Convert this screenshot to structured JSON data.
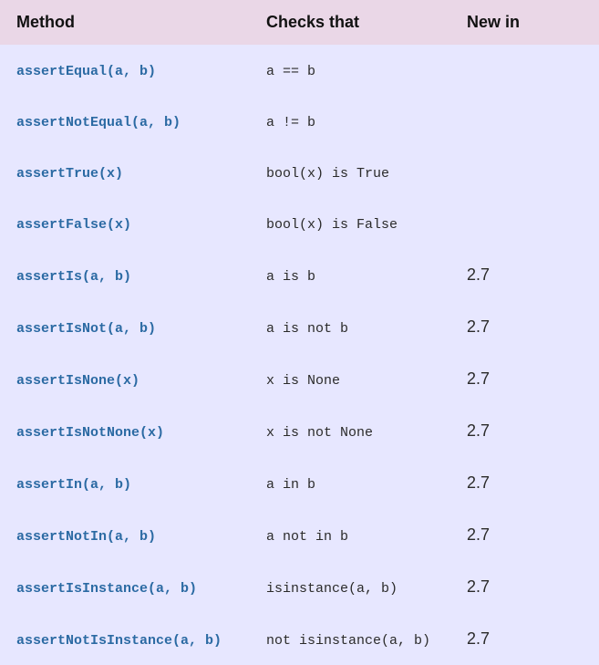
{
  "headers": {
    "method": "Method",
    "checks": "Checks that",
    "newin": "New in"
  },
  "rows": [
    {
      "method": "assertEqual(a, b)",
      "checks": "a == b",
      "newin": ""
    },
    {
      "method": "assertNotEqual(a, b)",
      "checks": "a != b",
      "newin": ""
    },
    {
      "method": "assertTrue(x)",
      "checks": "bool(x) is True",
      "newin": ""
    },
    {
      "method": "assertFalse(x)",
      "checks": "bool(x) is False",
      "newin": ""
    },
    {
      "method": "assertIs(a, b)",
      "checks": "a is b",
      "newin": "2.7"
    },
    {
      "method": "assertIsNot(a, b)",
      "checks": "a is not b",
      "newin": "2.7"
    },
    {
      "method": "assertIsNone(x)",
      "checks": "x is None",
      "newin": "2.7"
    },
    {
      "method": "assertIsNotNone(x)",
      "checks": "x is not None",
      "newin": "2.7"
    },
    {
      "method": "assertIn(a, b)",
      "checks": "a in b",
      "newin": "2.7"
    },
    {
      "method": "assertNotIn(a, b)",
      "checks": "a not in b",
      "newin": "2.7"
    },
    {
      "method": "assertIsInstance(a, b)",
      "checks": "isinstance(a, b)",
      "newin": "2.7"
    },
    {
      "method": "assertNotIsInstance(a, b)",
      "checks": "not isinstance(a, b)",
      "newin": "2.7"
    }
  ]
}
